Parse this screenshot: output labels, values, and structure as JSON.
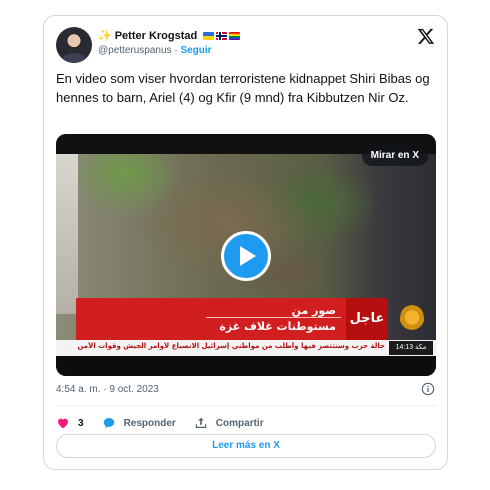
{
  "author": {
    "name": "Petter Krogstad",
    "handle": "@petteruspanus",
    "separator": "·",
    "follow_label": "Seguir",
    "sparkle": "✨"
  },
  "tweet": {
    "text": "En video som viser hvordan terroristene kidnappet Shiri Bibas og hennes to barn, Ariel (4) og Kfir (9 mnd) fra Kibbutzen Nir Oz.",
    "timestamp": "4:54 a. m. · 9 oct. 2023"
  },
  "media": {
    "watch_on_x_label": "Mirar en X",
    "banner_line1": "صور من",
    "banner_line2": "مستوطنات غلاف غزة",
    "breaking_label": "عاجل",
    "ticker_text": "حالة حرب وسنتتصر فيها وأطلب من مواطني إسرائيل الانصياع لأوامر الجيش وقوات الأمن",
    "ticker_time": "14:13 مكة"
  },
  "actions": {
    "like_count": "3",
    "reply_label": "Responder",
    "share_label": "Compartir"
  },
  "read_more_label": "Leer más en X",
  "colors": {
    "accent": "#1d9bf0",
    "like": "#f91880",
    "breaking_red": "#d11f1f"
  }
}
